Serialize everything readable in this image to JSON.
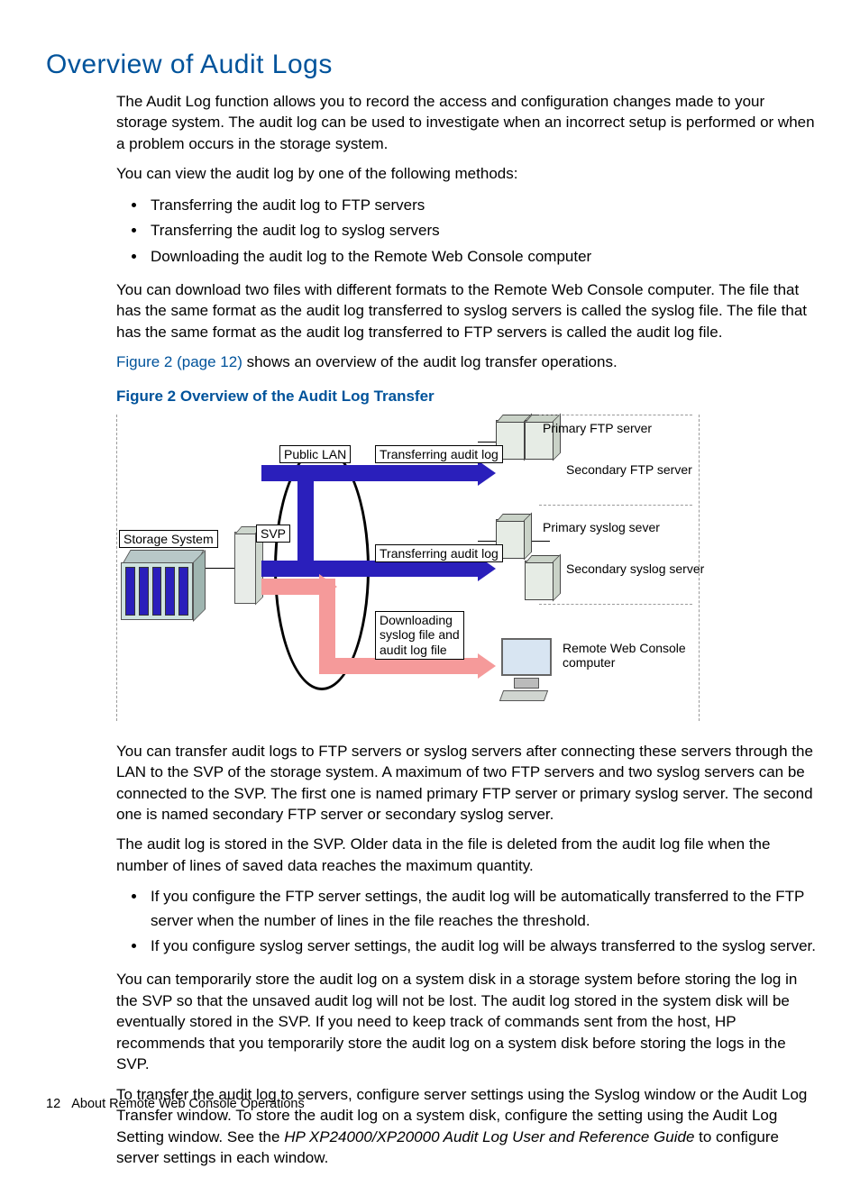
{
  "heading": "Overview of Audit Logs",
  "p1": "The Audit Log function allows you to record the access and configuration changes made to your storage system. The audit log can be used to investigate when an incorrect setup is performed or when a problem occurs in the storage system.",
  "p2": "You can view the audit log by one of the following methods:",
  "list1": [
    "Transferring the audit log to FTP servers",
    "Transferring the audit log to syslog servers",
    "Downloading the audit log to the Remote Web Console computer"
  ],
  "p3": "You can download two files with different formats to the Remote Web Console computer. The file that has the same format as the audit log transferred to syslog servers is called the syslog file. The file that has the same format as the audit log transferred to FTP servers is called the audit log file.",
  "p4a": "Figure 2 (page 12)",
  "p4b": " shows an overview of the audit log transfer operations.",
  "figcaption": "Figure 2 Overview of the Audit Log Transfer",
  "diagram": {
    "public_lan": "Public LAN",
    "svp": "SVP",
    "storage_system": "Storage System",
    "transfer": "Transferring audit log",
    "download": "Downloading\nsyslog file and\naudit log file",
    "primary_ftp": "Primary FTP server",
    "secondary_ftp": "Secondary FTP server",
    "primary_syslog": "Primary syslog sever",
    "secondary_syslog": "Secondary syslog server",
    "rwc": "Remote Web Console\ncomputer"
  },
  "p5": "You can transfer audit logs to FTP servers or syslog servers after connecting these servers through the LAN to the SVP of the storage system. A maximum of two FTP servers and two syslog servers can be connected to the SVP. The first one is named primary FTP server or primary syslog server. The second one is named secondary FTP server or secondary syslog server.",
  "p6": "The audit log is stored in the SVP. Older data in the file is deleted from the audit log file when the number of lines of saved data reaches the maximum quantity.",
  "list2": [
    "If you configure the FTP server settings, the audit log will be automatically transferred to the FTP server when the number of lines in the file reaches the threshold.",
    "If you configure syslog server settings, the audit log will be always transferred to the syslog server."
  ],
  "p7": "You can temporarily store the audit log on a system disk in a storage system before storing the log in the SVP so that the unsaved audit log will not be lost. The audit log stored in the system disk will be eventually stored in the SVP. If you need to keep track of commands sent from the host, HP recommends that you temporarily store the audit log on a system disk before storing the logs in the SVP.",
  "p8a": "To transfer the audit log to servers, configure server settings using the Syslog window or the Audit Log Transfer window. To store the audit log on a system disk, configure the setting using the Audit Log Setting window. See the ",
  "p8b": "HP XP24000/XP20000 Audit Log User and Reference Guide",
  "p8c": " to configure server settings in each window.",
  "footer_page": "12",
  "footer_text": "About Remote Web Console Operations"
}
